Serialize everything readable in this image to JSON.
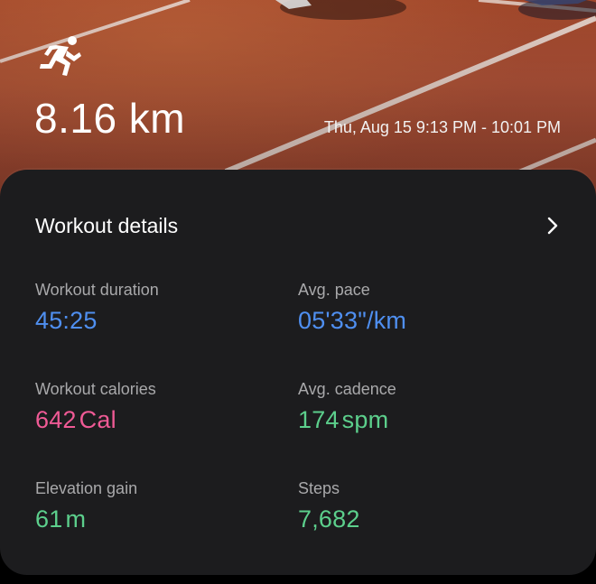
{
  "header": {
    "activity_icon": "running-icon",
    "distance": "8.16 km",
    "time_range": "Thu, Aug 15 9:13 PM - 10:01 PM"
  },
  "details": {
    "title": "Workout details",
    "chevron_icon": "chevron-right-icon",
    "stats": {
      "duration": {
        "label": "Workout duration",
        "value": "45:25",
        "color": "#4f8ff0"
      },
      "pace": {
        "label": "Avg. pace",
        "value": "05'33\"/km",
        "color": "#4f8ff0"
      },
      "calories": {
        "label": "Workout calories",
        "value": "642",
        "unit": "Cal",
        "color": "#ef5a95"
      },
      "cadence": {
        "label": "Avg. cadence",
        "value": "174",
        "unit": "spm",
        "color": "#5ccf8c"
      },
      "elevation": {
        "label": "Elevation gain",
        "value": "61",
        "unit": "m",
        "color": "#5ccf8c"
      },
      "steps": {
        "label": "Steps",
        "value": "7,682",
        "color": "#5ccf8c"
      }
    }
  }
}
